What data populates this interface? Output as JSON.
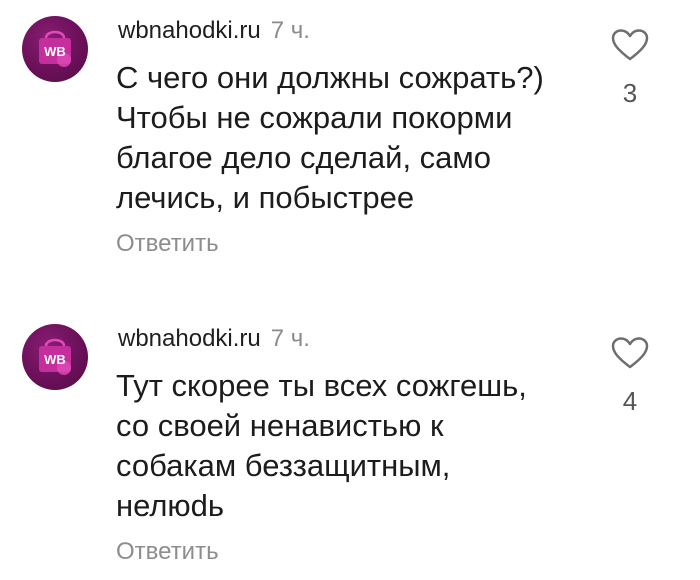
{
  "colors": {
    "avatar_bg": "#6a1059",
    "avatar_accent": "#d63cb0",
    "username": "#1f1f1f",
    "secondary": "#8d8d8d"
  },
  "comments": [
    {
      "avatar_text": "WB",
      "username": "wbnahodki.ru",
      "time": "7 ч.",
      "text": "С чего они должны сожрать?)\nЧтобы не сожрали покорми\nблагое дело сделай, само\nлечись, и побыстрее",
      "reply_label": "Ответить",
      "likes": "3",
      "like_icon": "heart-outline-icon"
    },
    {
      "avatar_text": "WB",
      "username": "wbnahodki.ru",
      "time": "7 ч.",
      "text": "Тут скорее ты всех сожгешь,\nсо своей ненавистью к\nсобакам беззащитным,\nнелюdь",
      "reply_label": "Ответить",
      "likes": "4",
      "like_icon": "heart-outline-icon"
    }
  ]
}
